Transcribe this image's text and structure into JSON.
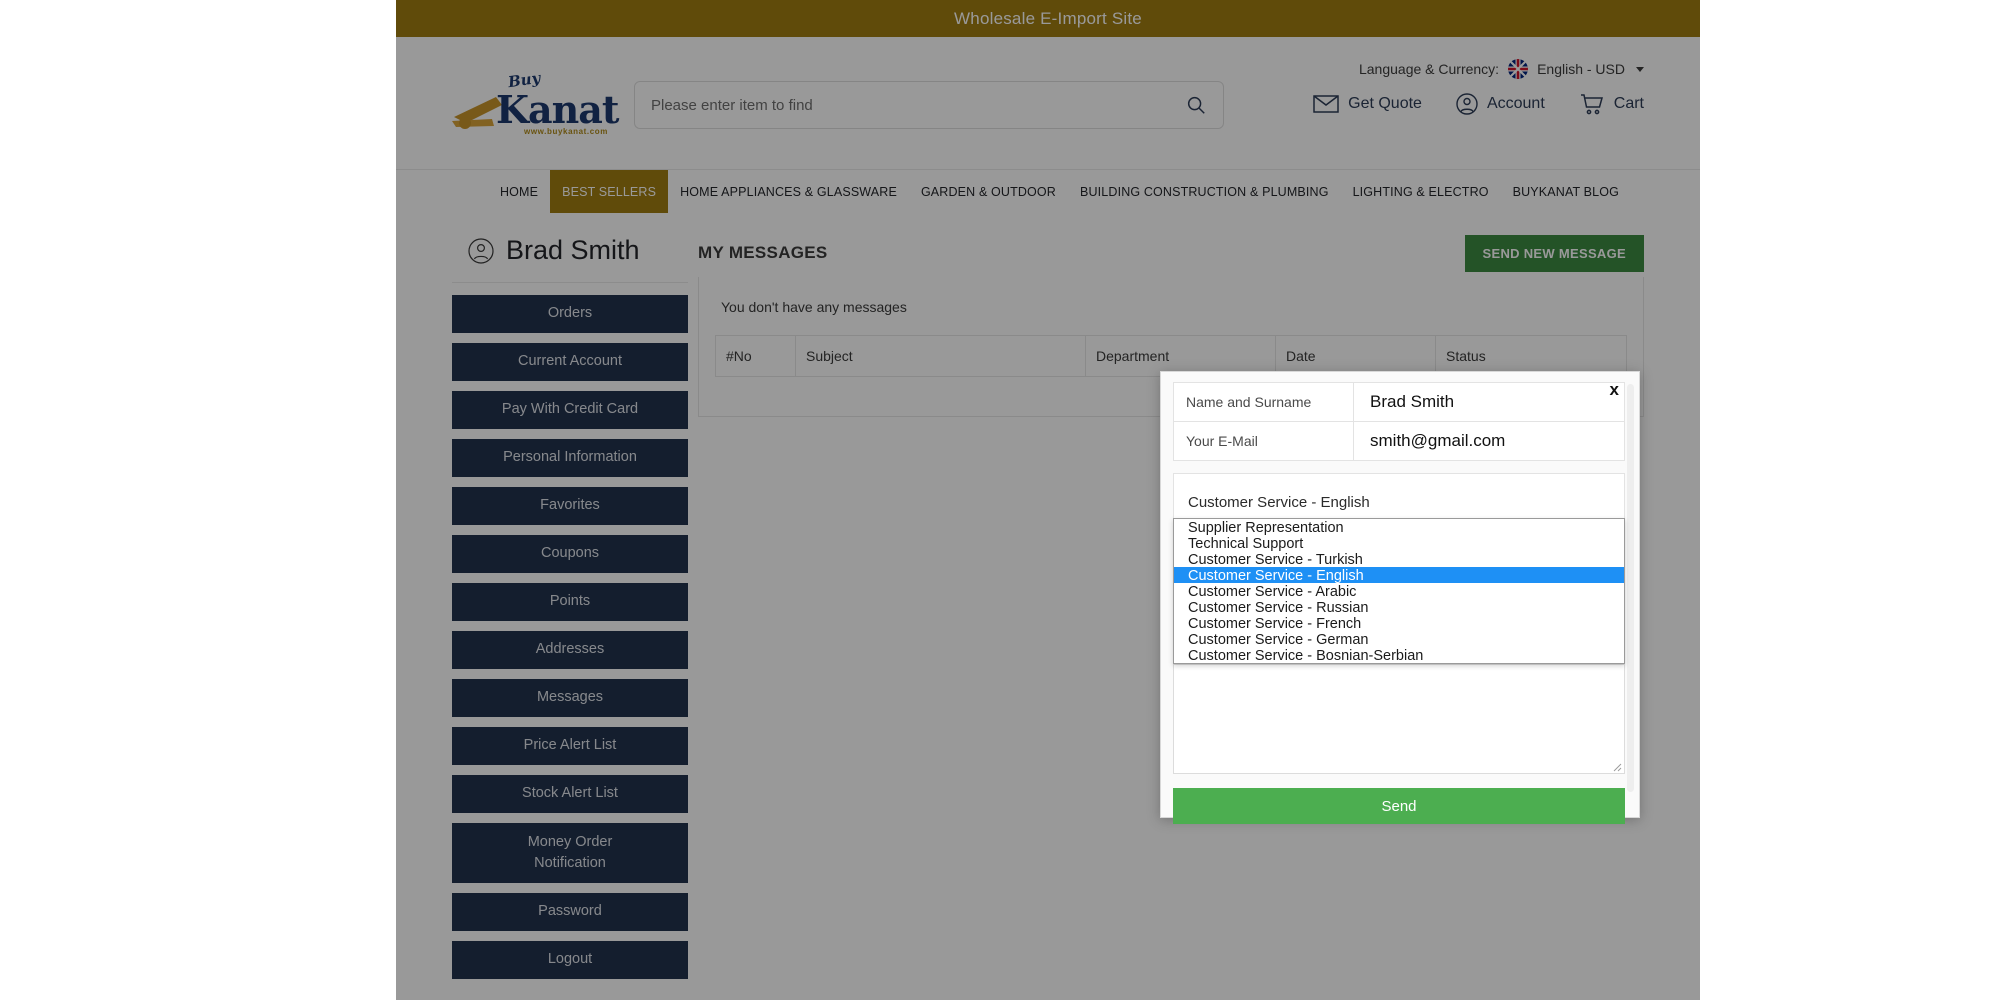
{
  "topbar": {
    "text": "Wholesale E-Import Site"
  },
  "logo": {
    "buy": "Buy",
    "word": "Kanat",
    "url": "www.buykanat.com"
  },
  "search": {
    "placeholder": "Please enter item to find",
    "value": ""
  },
  "header": {
    "language_label": "Language & Currency:",
    "language_value": "English - USD",
    "links": [
      {
        "label": "Get Quote",
        "icon": "envelope-icon"
      },
      {
        "label": "Account",
        "icon": "user-circle-icon"
      },
      {
        "label": "Cart",
        "icon": "cart-icon"
      }
    ]
  },
  "nav": {
    "items": [
      {
        "label": "HOME",
        "active": false
      },
      {
        "label": "BEST SELLERS",
        "active": true
      },
      {
        "label": "HOME APPLIANCES & GLASSWARE",
        "active": false
      },
      {
        "label": "GARDEN & OUTDOOR",
        "active": false
      },
      {
        "label": "BUILDING CONSTRUCTION & PLUMBING",
        "active": false
      },
      {
        "label": "LIGHTING & ELECTRO",
        "active": false
      },
      {
        "label": "BUYKANAT BLOG",
        "active": false
      }
    ]
  },
  "sidebar": {
    "user_name": "Brad Smith",
    "items": [
      {
        "label": "Orders"
      },
      {
        "label": "Current Account"
      },
      {
        "label": "Pay With Credit Card"
      },
      {
        "label": "Personal Information"
      },
      {
        "label": "Favorites"
      },
      {
        "label": "Coupons"
      },
      {
        "label": "Points"
      },
      {
        "label": "Addresses"
      },
      {
        "label": "Messages"
      },
      {
        "label": "Price Alert List"
      },
      {
        "label": "Stock Alert List"
      },
      {
        "label": "Money Order"
      },
      {
        "label": "Notification"
      },
      {
        "label": "Password"
      },
      {
        "label": "Logout"
      }
    ],
    "money_order_line1": "Money Order",
    "money_order_line2": "Notification"
  },
  "main": {
    "title": "MY MESSAGES",
    "send_new_label": "SEND NEW MESSAGE",
    "empty_text": "You don't have any messages",
    "table_headers": [
      "#No",
      "Subject",
      "Department",
      "Date",
      "Status"
    ]
  },
  "modal": {
    "close_label": "x",
    "name_label": "Name and Surname",
    "name_value": "Brad Smith",
    "email_label": "Your E-Mail",
    "email_value": "smith@gmail.com",
    "department_selected": "Customer Service - English",
    "department_options": [
      "Supplier Representation",
      "Technical Support",
      "Customer Service - Turkish",
      "Customer Service - English",
      "Customer Service - Arabic",
      "Customer Service - Russian",
      "Customer Service - French",
      "Customer Service - German",
      "Customer Service - Bosnian-Serbian"
    ],
    "selected_index": 3,
    "message_value": "",
    "send_label": "Send"
  },
  "colors": {
    "topbar": "#a07d12",
    "nav_active": "#a07d12",
    "sidebar_button": "#22334d",
    "send_new_button": "#3d8b41",
    "send_button": "#4cae50",
    "option_selected": "#1e90f5",
    "logo_navy": "#1d3a6e"
  }
}
